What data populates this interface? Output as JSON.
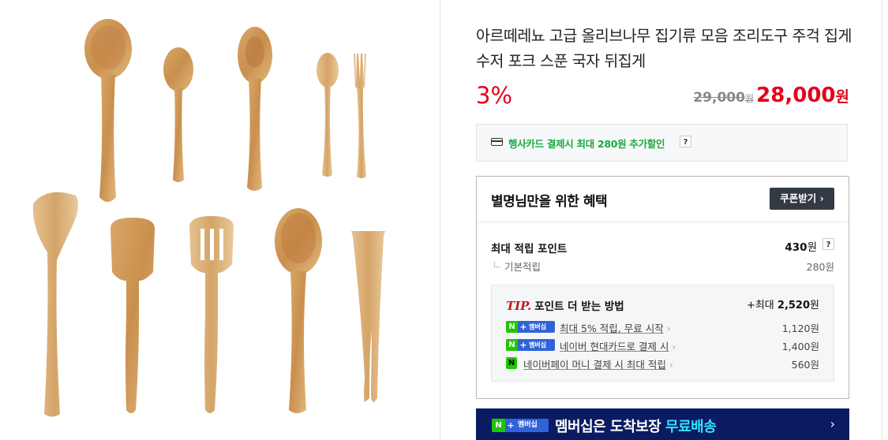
{
  "product": {
    "title": "아르떼레뇨 고급 올리브나무 집기류 모음 조리도구 주걱 집게 수저 포크 스푼 국자 뒤집게",
    "discount": "3%",
    "original_price": "29,000",
    "original_unit": "원",
    "sale_price": "28,000",
    "sale_unit": "원",
    "image_icon": "olive-wood-utensils-photo"
  },
  "card_promo": {
    "text": "행사카드 결제시 최대 280원 추가할인",
    "help": "?",
    "icon": "credit-card-icon",
    "color": "#1aaa3e"
  },
  "benefits": {
    "title": "별명님만을 위한 혜택",
    "coupon_button": "쿠폰받기 ›",
    "max_points_label": "최대 적립 포인트",
    "max_points_value": "430",
    "max_points_unit": "원",
    "help": "?",
    "basic_label": "기본적립",
    "basic_value": "280원",
    "tip": {
      "em": "TIP.",
      "title": "포인트 더 받는 방법",
      "max_prefix": "+최대",
      "max_value": "2,520",
      "max_unit": "원",
      "rows": [
        {
          "badge": "멤버십",
          "label": "최대 5% 적립, 무료 시작",
          "value": "1,120원"
        },
        {
          "badge": "멤버십",
          "label": "네이버 현대카드로 결제 시",
          "value": "1,400원"
        },
        {
          "badge": "N",
          "label": "네이버페이 머니 결제 시 최대 적립",
          "value": "560원"
        }
      ]
    }
  },
  "membership_banner": {
    "badge_n": "N",
    "badge_plus": "+",
    "badge_text": "멤버십",
    "text_prefix": "멤버십은 도착보장 ",
    "text_highlight": "무료배송",
    "chevron": "›",
    "bg_color": "#0b1b62",
    "highlight_color": "#30e5ff"
  },
  "colors": {
    "price_red": "#e3001b",
    "naver_green": "#1ec800",
    "membership_blue": "#3163d8"
  }
}
